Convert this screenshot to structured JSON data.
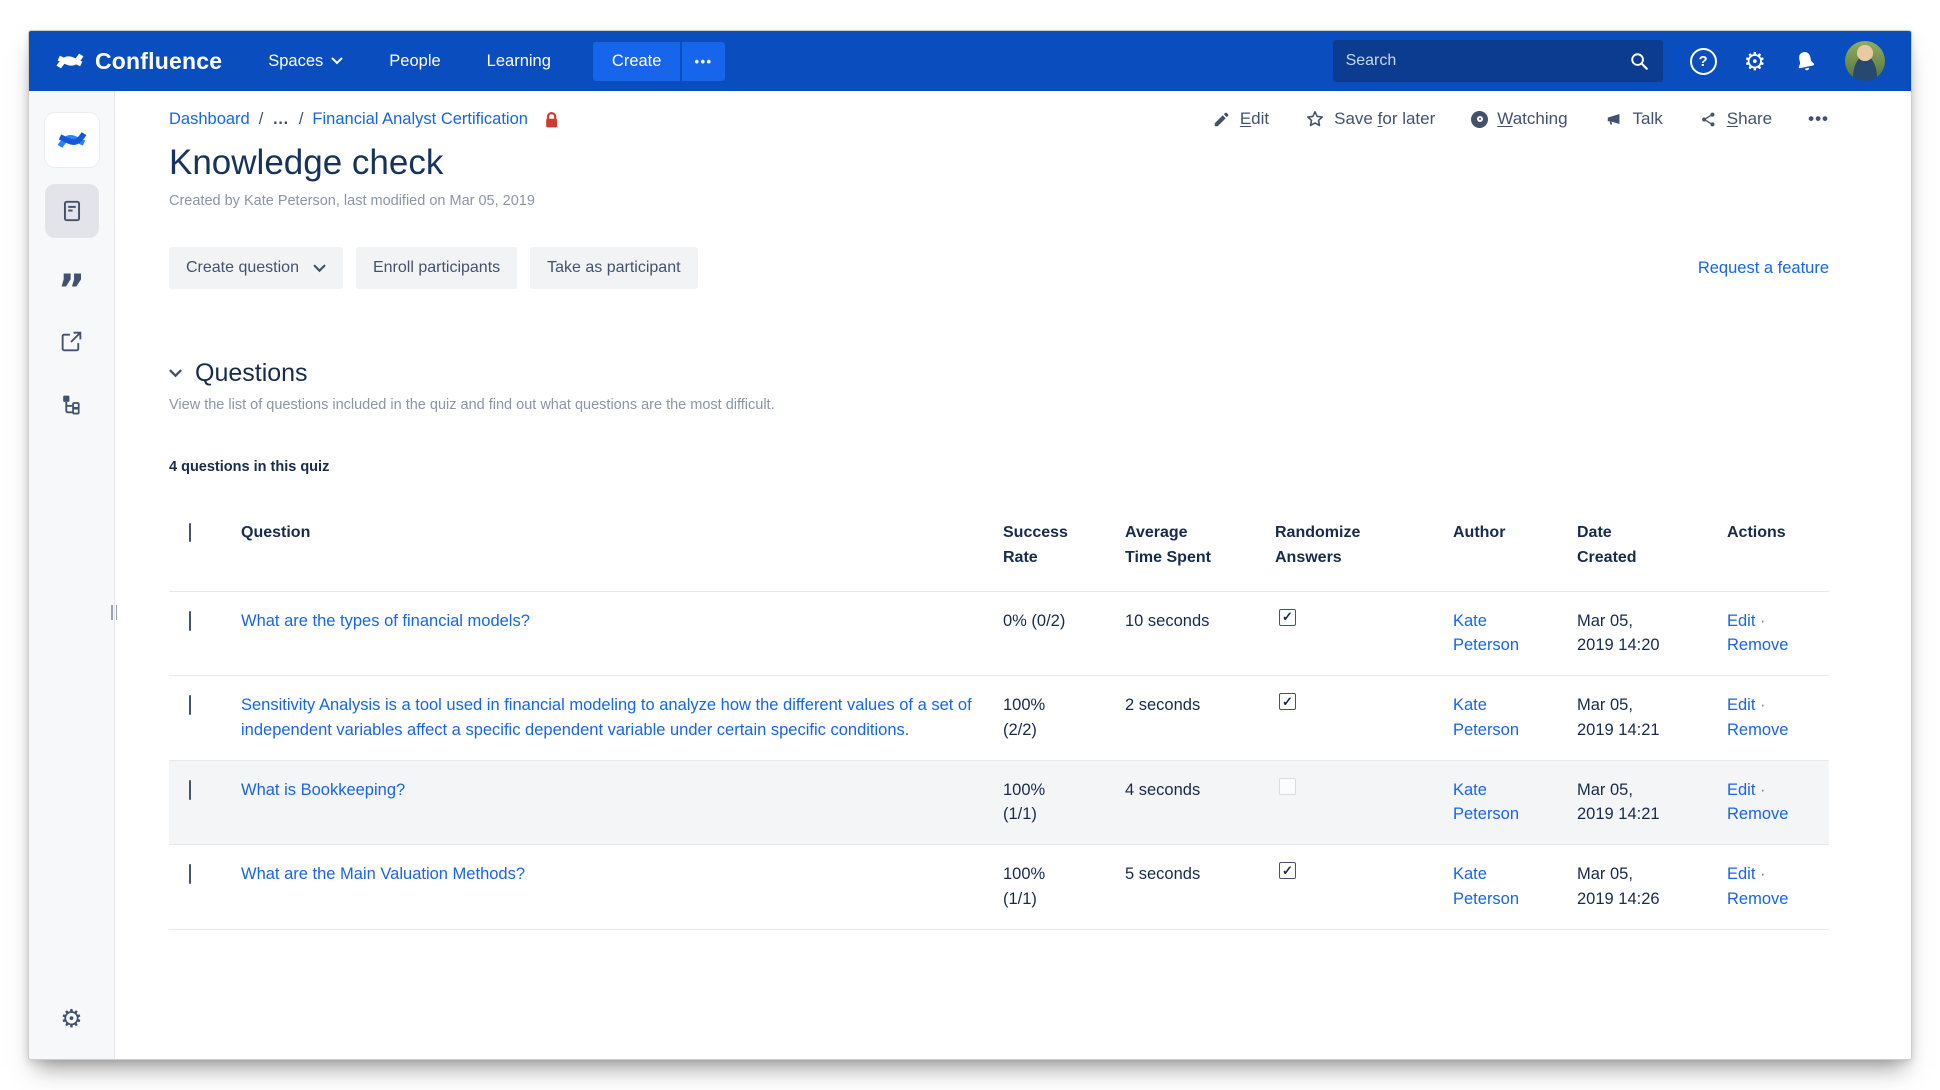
{
  "nav": {
    "brand": "Confluence",
    "menu": [
      "Spaces",
      "People",
      "Learning"
    ],
    "create_label": "Create",
    "more_label": "•••",
    "search_placeholder": "Search"
  },
  "breadcrumb": {
    "items": [
      "Dashboard",
      "…",
      "Financial Analyst Certification"
    ],
    "separator": "/"
  },
  "page_actions": {
    "edit": {
      "key": "E",
      "rest": "dit"
    },
    "save": {
      "pre": "Save ",
      "key": "f",
      "rest": "or later"
    },
    "watching": {
      "key": "W",
      "rest": "atching"
    },
    "talk": {
      "label": "Talk"
    },
    "share": {
      "key": "S",
      "rest": "hare"
    },
    "more": "•••"
  },
  "page": {
    "title": "Knowledge check",
    "byline": "Created by Kate Peterson, last modified on Mar 05, 2019"
  },
  "toolbar": {
    "create_question": "Create question",
    "enroll": "Enroll participants",
    "take": "Take as participant",
    "request_feature": "Request a feature"
  },
  "section": {
    "title": "Questions",
    "description": "View the list of questions included in the quiz and find out what questions are the most difficult.",
    "count": "4 questions in this quiz"
  },
  "table": {
    "headers": {
      "question": "Question",
      "success": "Success\nRate",
      "time": "Average\nTime Spent",
      "randomize": "Randomize\nAnswers",
      "author": "Author",
      "date": "Date\nCreated",
      "actions": "Actions"
    },
    "edit_label": "Edit",
    "remove_label": "Remove",
    "separator": "·",
    "rows": [
      {
        "question": "What are the types of financial models?",
        "success": "0% (0/2)",
        "time": "10 seconds",
        "randomize": true,
        "author": "Kate\nPeterson",
        "date": "Mar 05,\n2019 14:20"
      },
      {
        "question": "Sensitivity Analysis is a tool used in financial modeling to analyze how the different values of a set of independent variables affect a specific dependent variable under certain specific conditions.",
        "success": "100%\n(2/2)",
        "time": "2 seconds",
        "randomize": true,
        "author": "Kate\nPeterson",
        "date": "Mar 05,\n2019 14:21"
      },
      {
        "question": "What is Bookkeeping?",
        "success": "100%\n(1/1)",
        "time": "4 seconds",
        "randomize": false,
        "author": "Kate\nPeterson",
        "date": "Mar 05,\n2019 14:21"
      },
      {
        "question": "What are the Main Valuation Methods?",
        "success": "100%\n(1/1)",
        "time": "5 seconds",
        "randomize": true,
        "author": "Kate\nPeterson",
        "date": "Mar 05,\n2019 14:26"
      }
    ]
  }
}
